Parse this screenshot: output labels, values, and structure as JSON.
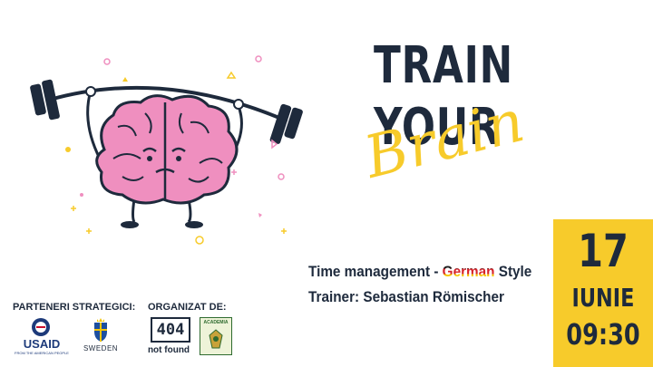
{
  "title": {
    "line1": "TRAIN",
    "line2": "YOUR",
    "line3": "Brain"
  },
  "event": {
    "topic_prefix": "Time management - ",
    "topic_highlight": "German",
    "topic_suffix": " Style",
    "trainer": "Trainer: Sebastian Römischer"
  },
  "date": {
    "day": "17",
    "month": "IUNIE",
    "time": "09:30"
  },
  "sponsors": {
    "partners_label": "PARTENERI STRATEGICI:",
    "organizers_label": "ORGANIZAT DE:",
    "usaid": "USAID",
    "usaid_tagline": "FROM THE AMERICAN PEOPLE",
    "sweden": "SWEDEN",
    "notfound_mark": "404",
    "notfound": "not found",
    "academia": "ACADEMIA"
  },
  "colors": {
    "navy": "#1e2a3c",
    "yellow": "#f7cb2b",
    "brain_pink": "#ef8fbf",
    "usaid_blue": "#1d3a7a",
    "usaid_red": "#c8102e"
  },
  "icons": {
    "illustration": "brain-lifting-barbell",
    "usaid_logo": "usaid-seal",
    "sweden_logo": "swedish-crest",
    "notfound_logo": "404-mark",
    "academia_logo": "academia-crest"
  }
}
